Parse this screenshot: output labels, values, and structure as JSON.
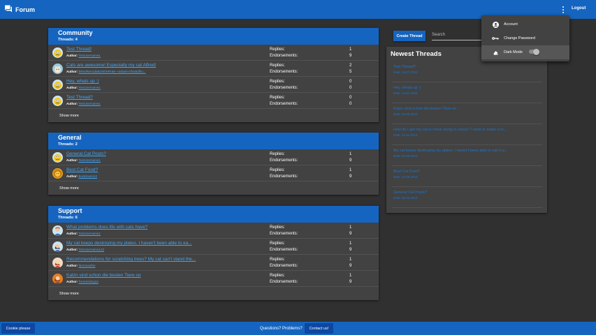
{
  "header": {
    "title": "Forum",
    "logout_label": "Logout"
  },
  "boards": [
    {
      "name": "Community",
      "count": "Threads: 4",
      "show_more": "Show more",
      "threads": [
        {
          "title": "Test Thread!",
          "author_label": "Author:",
          "author": "TestUsername1",
          "replies_label": "Replies:",
          "endorse_label": "Endorsements:",
          "replies": "1",
          "endorsements": "9",
          "avatar": "smiley"
        },
        {
          "title": "Cats are awesome! Especially my cat Alfred!",
          "author_label": "Author:",
          "author": "BRedRen1daB1W0HRnBr--rasbalt-rrrfasbdhlu...",
          "replies_label": "Replies:",
          "endorse_label": "Endorsements:",
          "replies": "2",
          "endorsements": "5",
          "avatar": "cat"
        },
        {
          "title": "Hey, whats up :)",
          "author_label": "Author:",
          "author": "TestUsername1",
          "replies_label": "Replies:",
          "endorse_label": "Endorsements:",
          "replies": "0",
          "endorsements": "0",
          "avatar": "smiley"
        },
        {
          "title": "Test Thread?",
          "author_label": "Author:",
          "author": "TestUsername1",
          "replies_label": "Replies:",
          "endorse_label": "Endorsements:",
          "replies": "0",
          "endorsements": "0",
          "avatar": "smiley"
        }
      ]
    },
    {
      "name": "General",
      "count": "Threads: 2",
      "show_more": "Show more",
      "threads": [
        {
          "title": "General Cat Posts?",
          "author_label": "Author:",
          "author": "TestUsername1",
          "replies_label": "Replies:",
          "endorse_label": "Endorsements:",
          "replies": "1",
          "endorsements": "9",
          "avatar": "smiley"
        },
        {
          "title": "Best Cat Food?",
          "author_label": "Author:",
          "author": "Bonkmann12",
          "replies_label": "Replies:",
          "endorse_label": "Endorsements:",
          "replies": "1",
          "endorsements": "9",
          "avatar": "lion"
        }
      ]
    },
    {
      "name": "Support",
      "count": "Threads: 6",
      "show_more": "Show more",
      "threads": [
        {
          "title": "What problems does life with cats have?",
          "author_label": "Author:",
          "author": "TestUsername1",
          "replies_label": "Replies:",
          "endorse_label": "Endorsements:",
          "replies": "1",
          "endorsements": "9",
          "avatar": "man"
        },
        {
          "title": "My cat keeps destroying my plates. I haven't been able to ea...",
          "author_label": "Author:",
          "author": "TestUsername123",
          "replies_label": "Replies:",
          "endorse_label": "Endorsements:",
          "replies": "1",
          "endorsements": "9",
          "avatar": "woman"
        },
        {
          "title": "Recommendations for scratching trees? My cat can't stand the...",
          "author_label": "Author:",
          "author": "farmmanthe",
          "replies_label": "Replies:",
          "endorse_label": "Endorsements:",
          "replies": "1",
          "endorsements": "9",
          "avatar": "girl"
        },
        {
          "title": "Katzn sind schon die besten Tiere oo",
          "author_label": "Author:",
          "author": "TomHelsing34",
          "replies_label": "Replies:",
          "endorse_label": "Endorsements:",
          "replies": "1",
          "endorsements": "9",
          "avatar": "redhead"
        }
      ]
    }
  ],
  "toolbar": {
    "create_label": "Create Thread",
    "search_placeholder": "Search"
  },
  "newest": {
    "title": "Newest Threads",
    "items": [
      {
        "title": "Test Thread?",
        "date": "Date: 18.07.2023"
      },
      {
        "title": "Hey, whats up :)",
        "date": "Date: 14.07.2023"
      },
      {
        "title": "Katzn sind schon die besten Tiere oo",
        "date": "Date: 10.03.2023"
      },
      {
        "title": "How do I get my cat to move along to music? I want to make a m...",
        "date": "Date: 12.11.2014"
      },
      {
        "title": "My cat keeps destroying my plates. I haven't been able to eat in p...",
        "date": "Date: 03.08.2014"
      },
      {
        "title": "Best Cat Food?",
        "date": "Date: 14.05.2014"
      },
      {
        "title": "General Cat Posts?",
        "date": "Date: 06.03.2014"
      }
    ]
  },
  "dropdown": {
    "account": "Account",
    "change_password": "Change Password",
    "dark_mode": "Dark Mode",
    "dark_mode_on": true
  },
  "footer": {
    "cookie_label": "Cookie please",
    "questions": "Questions? Problems?",
    "contact_label": "Contact us!"
  },
  "colors": {
    "primary": "#1565c0",
    "surface": "#424242",
    "background": "#303030",
    "link": "#42a5f5"
  }
}
